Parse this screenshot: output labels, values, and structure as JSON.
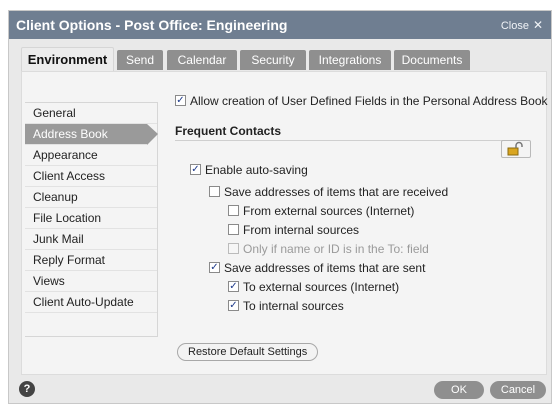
{
  "window": {
    "title": "Client Options - Post Office: Engineering",
    "close_label": "Close",
    "close_glyph": "✕"
  },
  "tabs": [
    {
      "label": "Environment",
      "active": true
    },
    {
      "label": "Send"
    },
    {
      "label": "Calendar"
    },
    {
      "label": "Security"
    },
    {
      "label": "Integrations"
    },
    {
      "label": "Documents"
    }
  ],
  "sidebar": {
    "items": [
      {
        "label": "General"
      },
      {
        "label": "Address Book",
        "active": true
      },
      {
        "label": "Appearance"
      },
      {
        "label": "Client Access"
      },
      {
        "label": "Cleanup"
      },
      {
        "label": "File Location"
      },
      {
        "label": "Junk Mail"
      },
      {
        "label": "Reply Format"
      },
      {
        "label": "Views"
      },
      {
        "label": "Client Auto-Update"
      }
    ]
  },
  "address_book": {
    "allow_udf": {
      "label": "Allow creation of User Defined Fields in the Personal Address Book",
      "checked": true
    },
    "frequent_contacts_title": "Frequent Contacts",
    "lock_icon": "lock-open-icon",
    "options": {
      "enable_auto_saving": {
        "label": "Enable auto-saving",
        "checked": true
      },
      "save_received": {
        "label": "Save addresses of items that are received",
        "checked": false
      },
      "from_external": {
        "label": "From external sources (Internet)",
        "checked": false
      },
      "from_internal": {
        "label": "From internal sources",
        "checked": false
      },
      "only_if_to": {
        "label": "Only if name or ID is in the To: field",
        "checked": false,
        "disabled": true
      },
      "save_sent": {
        "label": "Save addresses of items that are sent",
        "checked": true
      },
      "to_external": {
        "label": "To external sources (Internet)",
        "checked": true
      },
      "to_internal": {
        "label": "To internal sources",
        "checked": true
      }
    },
    "restore_label": "Restore Default Settings"
  },
  "footer": {
    "help_glyph": "?",
    "ok_label": "OK",
    "cancel_label": "Cancel"
  },
  "colors": {
    "titlebar": "#6f7e91",
    "tab_inactive": "#8f8f8f",
    "sidebar_active": "#9a9a9a",
    "check_mark": "#1d3a8a"
  }
}
